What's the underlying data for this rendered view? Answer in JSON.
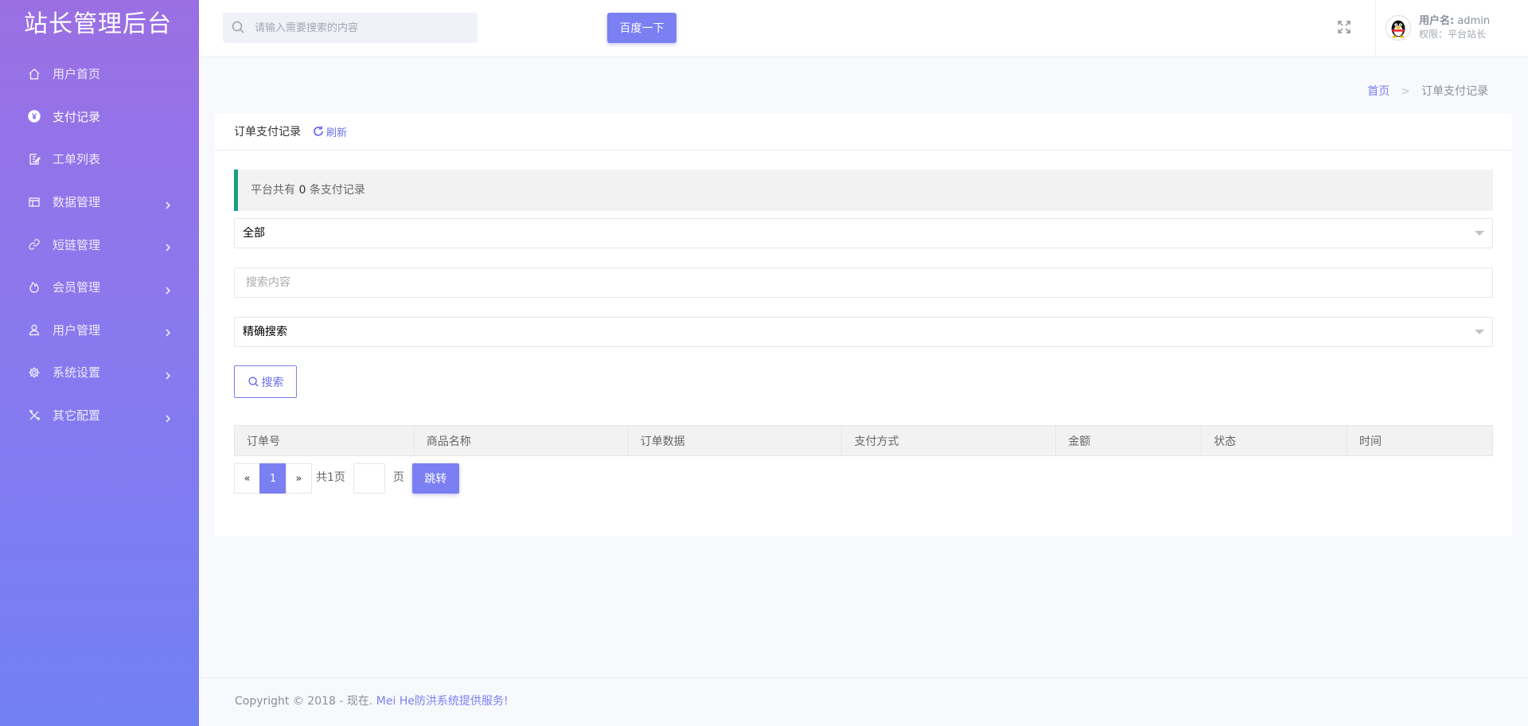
{
  "brand": "站长管理后台",
  "sidebar": {
    "items": [
      {
        "label": "用户首页",
        "icon": "home-icon"
      },
      {
        "label": "支付记录",
        "icon": "yen-icon",
        "active": true
      },
      {
        "label": "工单列表",
        "icon": "edit-doc-icon"
      },
      {
        "label": "数据管理",
        "icon": "table-icon",
        "has_children": true
      },
      {
        "label": "短链管理",
        "icon": "link-icon",
        "has_children": true
      },
      {
        "label": "会员管理",
        "icon": "fire-icon",
        "has_children": true
      },
      {
        "label": "用户管理",
        "icon": "user-icon",
        "has_children": true
      },
      {
        "label": "系统设置",
        "icon": "gear-icon",
        "has_children": true
      },
      {
        "label": "其它配置",
        "icon": "tools-icon",
        "has_children": true
      }
    ]
  },
  "header": {
    "search_placeholder": "请输入需要搜索的内容",
    "search_button": "百度一下",
    "user_name_label": "用户名:",
    "user_name": "admin",
    "user_role": "权限：平台站长"
  },
  "breadcrumb": {
    "home": "首页",
    "separator": ">",
    "current": "订单支付记录"
  },
  "card": {
    "title": "订单支付记录",
    "refresh_label": "刷新",
    "notice_prefix": "平台共有",
    "notice_count": "0",
    "notice_suffix": "条支付记录",
    "status_select": "全部",
    "search_placeholder": "搜索内容",
    "mode_select": "精确搜索",
    "search_button": "搜索"
  },
  "table": {
    "columns": [
      "订单号",
      "商品名称",
      "订单数据",
      "支付方式",
      "金额",
      "状态",
      "时间"
    ],
    "rows": []
  },
  "pager": {
    "prev": "«",
    "current": "1",
    "next": "»",
    "total_text": "共1页",
    "page_suffix": "页",
    "jump_button": "跳转"
  },
  "footer": {
    "copyright": "Copyright © 2018 - 现在.",
    "link_text": "Mei He防洪系统提供服务!"
  },
  "colors": {
    "accent": "#7a7ff2",
    "sidebar_top": "#9b6fe3",
    "sidebar_bottom": "#7280f4",
    "notice_bar": "#16a086"
  }
}
